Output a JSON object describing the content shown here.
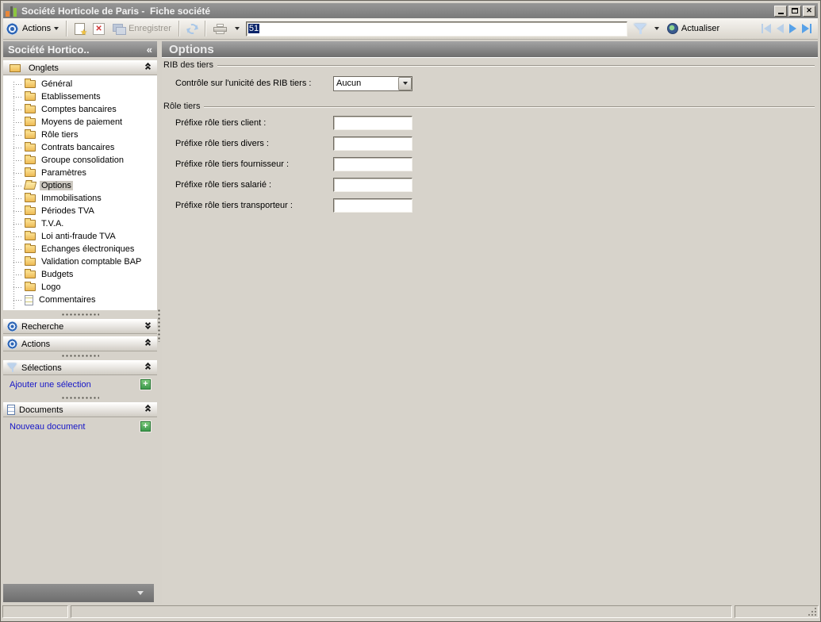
{
  "colors": {
    "link": "#1616c8",
    "selection": "#0a246a",
    "plus_green": "#3c9a4c",
    "header_gray": "#8a8a8a",
    "nav_enabled_blue": "#57a1e8",
    "nav_disabled_blue": "#b9cfe8"
  },
  "icons": {
    "close": "✕",
    "star": "★",
    "plus": "+",
    "collapse": "«"
  },
  "window": {
    "title": "Société Horticole de Paris -  Fiche société"
  },
  "toolbar": {
    "actions_label": "Actions",
    "save_label": "Enregistrer",
    "record_value": "51",
    "refresh_label": "Actualiser"
  },
  "sidebar": {
    "title": "Société Hortico..",
    "onglets": {
      "label": "Onglets",
      "items": [
        {
          "label": "Général",
          "icon": "folder",
          "icon_name": "folder-icon"
        },
        {
          "label": "Etablissements",
          "icon": "folder",
          "icon_name": "folder-icon"
        },
        {
          "label": "Comptes bancaires",
          "icon": "folder",
          "icon_name": "folder-icon"
        },
        {
          "label": "Moyens de paiement",
          "icon": "folder",
          "icon_name": "folder-icon"
        },
        {
          "label": "Rôle tiers",
          "icon": "folder",
          "icon_name": "folder-icon"
        },
        {
          "label": "Contrats bancaires",
          "icon": "folder",
          "icon_name": "folder-icon"
        },
        {
          "label": "Groupe consolidation",
          "icon": "folder",
          "icon_name": "folder-icon"
        },
        {
          "label": "Paramètres",
          "icon": "folder",
          "icon_name": "folder-icon"
        },
        {
          "label": "Options",
          "icon": "folder-open",
          "icon_name": "folder-open-icon",
          "selected": true
        },
        {
          "label": "Immobilisations",
          "icon": "folder",
          "icon_name": "folder-icon"
        },
        {
          "label": "Périodes TVA",
          "icon": "folder",
          "icon_name": "folder-icon"
        },
        {
          "label": "T.V.A.",
          "icon": "folder",
          "icon_name": "folder-icon"
        },
        {
          "label": "Loi anti-fraude TVA",
          "icon": "folder",
          "icon_name": "folder-icon"
        },
        {
          "label": "Echanges électroniques",
          "icon": "folder",
          "icon_name": "folder-icon"
        },
        {
          "label": "Validation comptable BAP",
          "icon": "folder",
          "icon_name": "folder-icon"
        },
        {
          "label": "Budgets",
          "icon": "folder",
          "icon_name": "folder-icon"
        },
        {
          "label": "Logo",
          "icon": "folder",
          "icon_name": "folder-icon"
        },
        {
          "label": "Commentaires",
          "icon": "page",
          "icon_name": "page-icon"
        }
      ]
    },
    "recherche": {
      "label": "Recherche"
    },
    "actions": {
      "label": "Actions"
    },
    "selections": {
      "label": "Sélections",
      "add_link": "Ajouter une sélection"
    },
    "documents": {
      "label": "Documents",
      "add_link": "Nouveau document"
    }
  },
  "main": {
    "title": "Options",
    "rib_group": {
      "title": "RIB des tiers",
      "field_label": "Contrôle sur l'unicité des RIB tiers :",
      "field_value": "Aucun"
    },
    "role_group": {
      "title": "Rôle tiers",
      "fields": [
        {
          "label": "Préfixe rôle tiers client :",
          "value": ""
        },
        {
          "label": "Préfixe rôle tiers divers :",
          "value": ""
        },
        {
          "label": "Préfixe rôle tiers fournisseur :",
          "value": ""
        },
        {
          "label": "Préfixe rôle tiers salarié :",
          "value": ""
        },
        {
          "label": "Préfixe rôle tiers transporteur :",
          "value": ""
        }
      ]
    }
  }
}
